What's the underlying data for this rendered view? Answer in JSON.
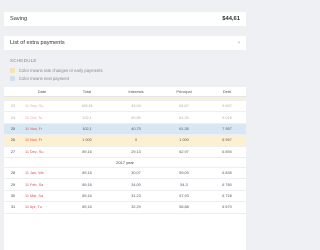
{
  "saving": {
    "label": "Saving",
    "value": "$44,61"
  },
  "extra_payments": {
    "label": "List of extra payments",
    "chevron": "chevron-right-icon"
  },
  "schedule": {
    "title": "SCHEDULE",
    "legend_rate": "Color means rate changes or early payments",
    "legend_next": "Color means next payment",
    "colors": {
      "rate": "#fbf0d2",
      "next": "#d8e7f4"
    }
  },
  "table": {
    "headers": [
      "",
      "Date",
      "Total",
      "Interests",
      "Principal",
      "Debt"
    ],
    "rows": [
      {
        "n": "",
        "date": "",
        "total": "",
        "int": "",
        "prin": "",
        "debt": "",
        "style": "rate-top"
      },
      {
        "n": "23",
        "date": "11 Sep, Su",
        "total": "108,61",
        "int": "43,94",
        "prin": "64,67",
        "debt": "9 697",
        "style": "faded"
      },
      {
        "n": "24",
        "date": "11 Oct, Tu",
        "total": "102,1",
        "int": "40,90",
        "prin": "61,20",
        "debt": "9 015",
        "style": "faded"
      },
      {
        "n": "25",
        "date": "11 Nov, Fr",
        "total": "102,1",
        "int": "40,75",
        "prin": "61,35",
        "debt": "7 957",
        "style": "next"
      },
      {
        "n": "26",
        "date": "11 Nov, Fr",
        "total": "1 000",
        "int": "0",
        "prin": "1 000",
        "debt": "6 957",
        "style": "rate"
      },
      {
        "n": "27",
        "date": "11 Dec, Su",
        "total": "89,16",
        "int": "29,13",
        "prin": "62,97",
        "debt": "6 894",
        "style": ""
      }
    ],
    "year_label": "2017 year",
    "rows2": [
      {
        "n": "28",
        "date": "11 Jan, We",
        "total": "89,16",
        "int": "30,07",
        "prin": "59,09",
        "debt": "6 835",
        "style": ""
      },
      {
        "n": "29",
        "date": "11 Feb, Sa",
        "total": "89,16",
        "int": "34,00",
        "prin": "54,3",
        "debt": "6 780",
        "style": ""
      },
      {
        "n": "30",
        "date": "11 Mar, Sa",
        "total": "89,16",
        "int": "31,23",
        "prin": "57,93",
        "debt": "6 728",
        "style": ""
      },
      {
        "n": "31",
        "date": "11 Apr, Tu",
        "total": "89,16",
        "int": "32,29",
        "prin": "56,88",
        "debt": "6 670",
        "style": ""
      }
    ]
  }
}
